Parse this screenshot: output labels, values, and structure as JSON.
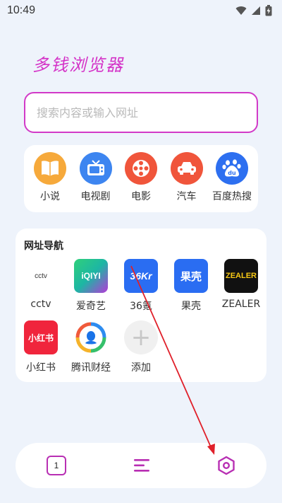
{
  "status_bar": {
    "time": "10:49",
    "icons": [
      "wifi-icon",
      "signal-icon",
      "battery-icon"
    ]
  },
  "brand": {
    "title": "多钱浏览器",
    "color": "#d431c7"
  },
  "search": {
    "placeholder": "搜索内容或输入网址",
    "value": ""
  },
  "quick_links": [
    {
      "label": "小说",
      "icon": "book-icon",
      "color": "#f6a93b"
    },
    {
      "label": "电视剧",
      "icon": "tv-icon",
      "color": "#3d85f0"
    },
    {
      "label": "电影",
      "icon": "film-reel-icon",
      "color": "#f0553b"
    },
    {
      "label": "汽车",
      "icon": "car-icon",
      "color": "#f0553b"
    },
    {
      "label": "百度热搜",
      "icon": "baidu-paw-icon",
      "color": "#2d6ff0"
    }
  ],
  "site_nav": {
    "title": "网址导航",
    "sites": [
      {
        "label": "cctv",
        "logo_text": "cctv"
      },
      {
        "label": "爱奇艺",
        "logo_text": "iQIYI"
      },
      {
        "label": "36氪",
        "logo_text": "36Kr"
      },
      {
        "label": "果壳",
        "logo_text": "果壳"
      },
      {
        "label": "ZEALER",
        "logo_text": "ZEALER"
      },
      {
        "label": "小红书",
        "logo_text": "小红书"
      },
      {
        "label": "腾讯财经",
        "logo_text": ""
      },
      {
        "label": "添加",
        "logo_text": "+"
      }
    ]
  },
  "bottom_bar": {
    "tab_count": "1",
    "menu_icon": "menu-icon",
    "settings_icon": "settings-hexagon-icon",
    "accent": "#b82fb3"
  },
  "annotation": {
    "arrow_color": "#e0202a"
  }
}
